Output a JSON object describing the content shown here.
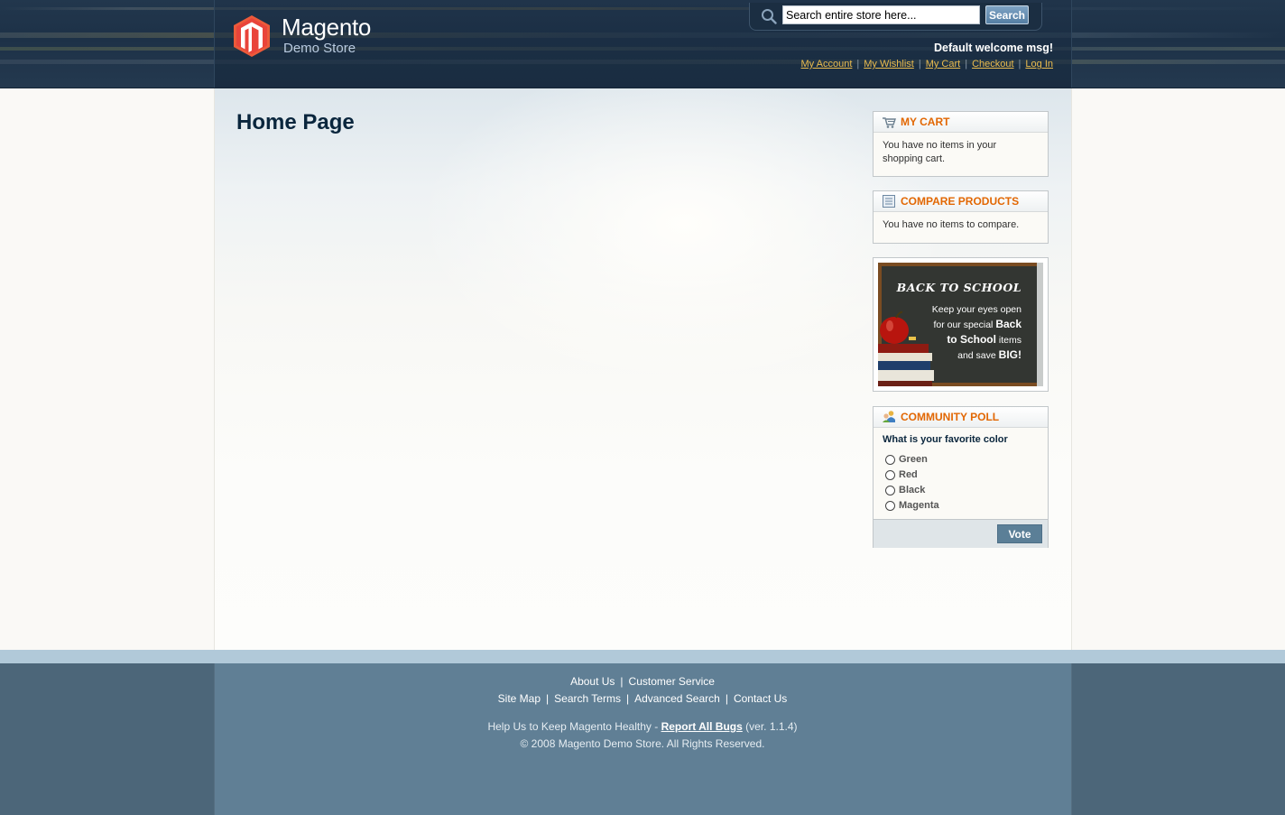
{
  "header": {
    "logo_name": "Magento",
    "logo_sub": "Demo Store",
    "welcome": "Default welcome msg!",
    "links": [
      "My Account",
      "My Wishlist",
      "My Cart",
      "Checkout",
      "Log In"
    ]
  },
  "search": {
    "value": "Search entire store here...",
    "button": "Search",
    "icon": "search-icon"
  },
  "main": {
    "title": "Home Page"
  },
  "sidebar": {
    "cart": {
      "title": "My Cart",
      "text": "You have no items in your shopping cart."
    },
    "compare": {
      "title": "Compare Products",
      "text": "You have no items to compare."
    },
    "banner": {
      "heading": "BACK TO SCHOOL",
      "line1": "Keep your eyes open",
      "line2_pre": "for our special ",
      "line2_bold": "Back",
      "line3_bold": "to School",
      "line3_post": " items",
      "line4_pre": "and save ",
      "line4_bold": "BIG!"
    },
    "poll": {
      "title": "Community Poll",
      "question": "What is your favorite color",
      "options": [
        "Green",
        "Red",
        "Black",
        "Magenta"
      ],
      "vote": "Vote"
    }
  },
  "footer": {
    "row1": [
      "About Us",
      "Customer Service"
    ],
    "row2": [
      "Site Map",
      "Search Terms",
      "Advanced Search",
      "Contact Us"
    ],
    "help_pre": "Help Us to Keep Magento Healthy - ",
    "help_link": "Report All Bugs",
    "help_post": " (ver. 1.1.4)",
    "copyright": "© 2008 Magento Demo Store. All Rights Reserved."
  },
  "colors": {
    "header_bg": "#1d3147",
    "accent_orange": "#e26703",
    "link_gold": "#ebbc4e",
    "footer_bg": "#607f95",
    "title_navy": "#0a263d"
  }
}
